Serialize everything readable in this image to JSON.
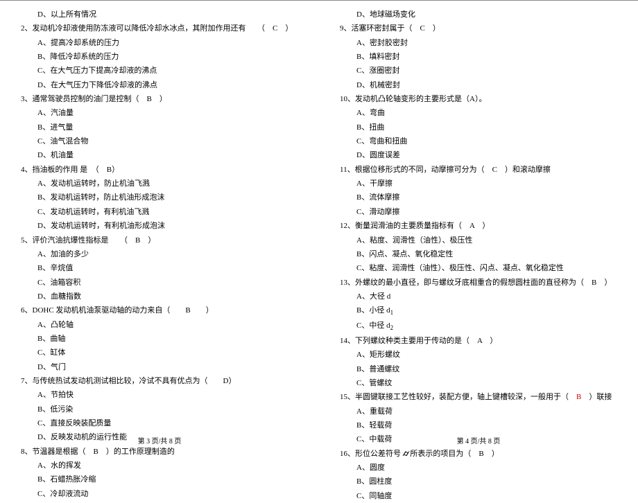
{
  "left": {
    "items": [
      {
        "type": "opt",
        "text": "D、以上所有情况"
      },
      {
        "type": "q",
        "text": "2、发动机冷却液使用防冻液可以降低冷却水冰点，其附加作用还有　　（　C　）"
      },
      {
        "type": "opt",
        "text": "A、提高冷却系统的压力"
      },
      {
        "type": "opt",
        "text": "B、降低冷却系统的压力"
      },
      {
        "type": "opt",
        "text": "C、在大气压力下提高冷却液的沸点"
      },
      {
        "type": "opt",
        "text": "D、在大气压力下降低冷却液的沸点"
      },
      {
        "type": "q",
        "text": "3、通常驾驶员控制的油门是控制（　B　）"
      },
      {
        "type": "opt",
        "text": "A、汽油量"
      },
      {
        "type": "opt",
        "text": "B、进气量"
      },
      {
        "type": "opt",
        "text": "C、油气混合物"
      },
      {
        "type": "opt",
        "text": "D、机油量"
      },
      {
        "type": "q",
        "text": "4、挡油板的作用 是　（　B）"
      },
      {
        "type": "opt",
        "text": "A、发动机运转时，防止机油飞溅"
      },
      {
        "type": "opt",
        "text": "B、发动机运转时，防止机油形成泡沫"
      },
      {
        "type": "opt",
        "text": "C、发动机运转时，有利机油飞溅"
      },
      {
        "type": "opt",
        "text": "D、发动机运转时，有利机油形成泡沫"
      },
      {
        "type": "q",
        "text": "5、评价汽油抗爆性指标是　　（　B　）"
      },
      {
        "type": "opt",
        "text": "A、加油的多少"
      },
      {
        "type": "opt",
        "text": "B、辛烷值"
      },
      {
        "type": "opt",
        "text": "C、油箱容积"
      },
      {
        "type": "opt",
        "text": "D、血糖指数"
      },
      {
        "type": "q",
        "text": "6、DOHC 发动机机油泵驱动轴的动力来自（　　B　　）"
      },
      {
        "type": "opt",
        "text": "A、凸轮轴"
      },
      {
        "type": "opt",
        "text": "B、曲轴"
      },
      {
        "type": "opt",
        "text": "C、缸体"
      },
      {
        "type": "opt",
        "text": "D、气门"
      },
      {
        "type": "q",
        "text": "7、与传统热试发动机测试相比较，冷试不具有优点为（　　D）"
      },
      {
        "type": "opt",
        "text": "A、节拍快"
      },
      {
        "type": "opt",
        "text": "B、低污染"
      },
      {
        "type": "opt",
        "text": "C、直接反映装配质量"
      },
      {
        "type": "opt",
        "text": "D、反映发动机的运行性能"
      },
      {
        "type": "q",
        "text": "8、节温器是根据（　B　）的工作原理制造的"
      },
      {
        "type": "opt",
        "text": "A、水的挥发"
      },
      {
        "type": "opt",
        "text": "B、石蜡热胀冷缩"
      },
      {
        "type": "opt",
        "text": "C、冷却液流动"
      }
    ],
    "footer": "第 3 页/共 8 页"
  },
  "right": {
    "items": [
      {
        "type": "opt",
        "text": "D、地球磁场变化"
      },
      {
        "type": "q",
        "text": "9、活塞环密封属于（　C　）"
      },
      {
        "type": "opt",
        "text": "A、密封胶密封"
      },
      {
        "type": "opt",
        "text": "B、填料密封"
      },
      {
        "type": "opt",
        "text": "C、涨圈密封"
      },
      {
        "type": "opt",
        "text": "D、机械密封"
      },
      {
        "type": "q",
        "text": "10、发动机凸轮轴变形的主要形式是（A）。"
      },
      {
        "type": "opt",
        "text": "A、弯曲"
      },
      {
        "type": "opt",
        "text": "B、扭曲"
      },
      {
        "type": "opt",
        "text": "C、弯曲和扭曲"
      },
      {
        "type": "opt",
        "text": "D、圆度误差"
      },
      {
        "type": "q",
        "text": "11、根据位移形式的不同，动摩擦可分为（　C　）和滚动摩擦"
      },
      {
        "type": "opt",
        "text": "A、干摩擦"
      },
      {
        "type": "opt",
        "text": "B、流体摩擦"
      },
      {
        "type": "opt",
        "text": "C、滑动摩擦"
      },
      {
        "type": "q",
        "text": "12、衡量润滑油的主要质量指标有（　A　）"
      },
      {
        "type": "opt",
        "text": "A、粘度、润滑性（油性）、极压性"
      },
      {
        "type": "opt",
        "text": "B、闪点、凝点、氧化稳定性"
      },
      {
        "type": "opt",
        "text": "C、粘度、润滑性（油性）、极压性、闪点、凝点、氧化稳定性"
      },
      {
        "type": "q",
        "text": "13、外螺纹的最小直径，即与螺纹牙底相重合的假想圆柱面的直径称为（　B　）"
      },
      {
        "type": "opt",
        "text": "A、大径 d"
      },
      {
        "type": "opt",
        "html": "B、小径 d<sub>1</sub>"
      },
      {
        "type": "opt",
        "html": "C、中径 d<sub>2</sub>"
      },
      {
        "type": "q",
        "text": "14、下列螺纹种类主要用于传动的是（　A　）"
      },
      {
        "type": "opt",
        "text": "A、矩形螺纹"
      },
      {
        "type": "opt",
        "text": "B、普通螺纹"
      },
      {
        "type": "opt",
        "text": "C、管螺纹"
      },
      {
        "type": "q",
        "html": "15、半圆键联接工艺性较好，装配方便，轴上键槽较深，一般用于（　<span class=\"red\">B</span>　）联接"
      },
      {
        "type": "opt",
        "text": "A、重载荷"
      },
      {
        "type": "opt",
        "text": "B、轻载荷"
      },
      {
        "type": "opt",
        "text": "C、中载荷"
      },
      {
        "type": "q",
        "html": "16、形位公差符号 <span class=\"sym\">⌭</span> 所表示的项目为（　B　）"
      },
      {
        "type": "opt",
        "text": "A、圆度"
      },
      {
        "type": "opt",
        "text": "B、圆柱度"
      },
      {
        "type": "opt",
        "text": "C、同轴度"
      }
    ],
    "footer": "第 4 页/共 8 页"
  }
}
